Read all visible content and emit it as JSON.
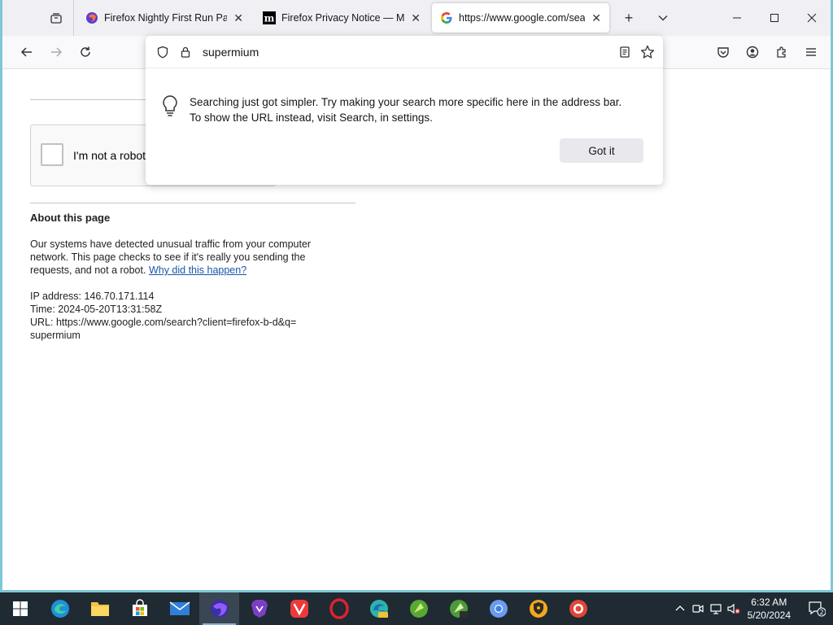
{
  "tabs": [
    {
      "title": "Firefox Nightly First Run Page",
      "favicon": "firefox-icon",
      "active": false
    },
    {
      "title": "Firefox Privacy Notice — Mozill",
      "favicon": "mozilla-m-icon",
      "active": false
    },
    {
      "title": "https://www.google.com/searc",
      "favicon": "google-g-icon",
      "active": true
    }
  ],
  "tab_close_glyph": "✕",
  "new_tab_glyph": "+",
  "address_bar": {
    "value": "supermium"
  },
  "search_tip": {
    "line1": "Searching just got simpler. Try making your search more specific here in the address bar.",
    "line2": "To show the URL instead, visit Search, in settings.",
    "button": "Got it"
  },
  "page": {
    "captcha_label": "I'm not a robot",
    "about_heading": "About this page",
    "paragraph": "Our systems have detected unusual traffic from your computer network. This page checks to see if it's really you sending the requests, and not a robot.",
    "why_link": "Why did this happen?",
    "ip_line": "IP address: 146.70.171.114",
    "time_line": "Time: 2024-05-20T13:31:58Z",
    "url_line": "URL: https://www.google.com/search?client=firefox-b-d&q=supermium"
  },
  "taskbar": {
    "apps": [
      "start-icon",
      "edge-icon",
      "file-explorer-icon",
      "store-icon",
      "mail-icon",
      "firefox-nightly-icon",
      "brave-icon",
      "vivaldi-icon",
      "opera-icon",
      "edge-canary-icon",
      "browser-green-icon",
      "browser-green-2-icon",
      "chromium-icon",
      "browser-shield-icon",
      "browser-red-icon"
    ],
    "active_app": "firefox-nightly-icon",
    "time": "6:32 AM",
    "date": "5/20/2024",
    "notification_count": "2"
  },
  "colors": {
    "desktop_accent": "#7fc7d6",
    "taskbar": "#1f2a33",
    "link": "#1a55a8"
  }
}
